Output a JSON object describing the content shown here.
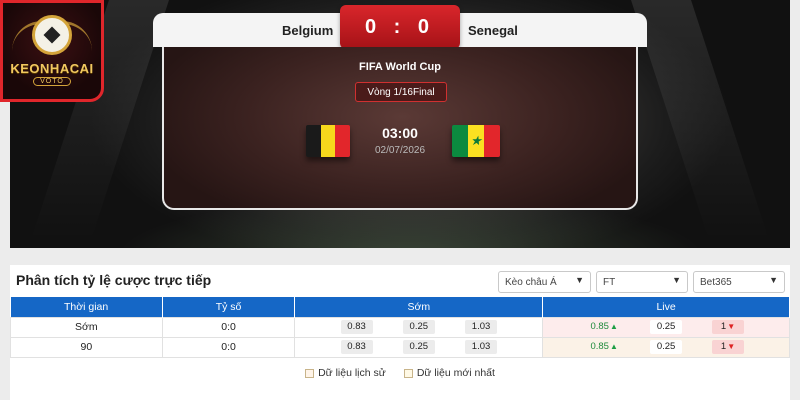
{
  "logo": {
    "brand": "KEONHACAI",
    "sub": "VOTO"
  },
  "match": {
    "home_team": "Belgium",
    "away_team": "Senegal",
    "score": "0 : 0",
    "competition": "FIFA World Cup",
    "round": "Vòng 1/16Final",
    "time": "03:00",
    "date": "02/07/2026"
  },
  "odds": {
    "title": "Phân tích tỷ lệ cược trực tiếp",
    "filters": {
      "type": "Kèo châu Á",
      "period": "FT",
      "bookmaker": "Bet365"
    },
    "headers": [
      "Thời gian",
      "Tỷ số",
      "Sớm",
      "Live"
    ],
    "rows": [
      {
        "time": "Sớm",
        "score": "0:0",
        "early": [
          "0.83",
          "0.25",
          "1.03"
        ],
        "live": [
          "0.85",
          "0.25",
          "1"
        ]
      },
      {
        "time": "90",
        "score": "0:0",
        "early": [
          "0.83",
          "0.25",
          "1.03"
        ],
        "live": [
          "0.85",
          "0.25",
          "1"
        ]
      }
    ],
    "legend": {
      "history": "Dữ liệu lịch sử",
      "latest": "Dữ liệu mới nhất"
    }
  },
  "colors": {
    "accent_red": "#d9262b",
    "header_blue": "#1567c6"
  }
}
